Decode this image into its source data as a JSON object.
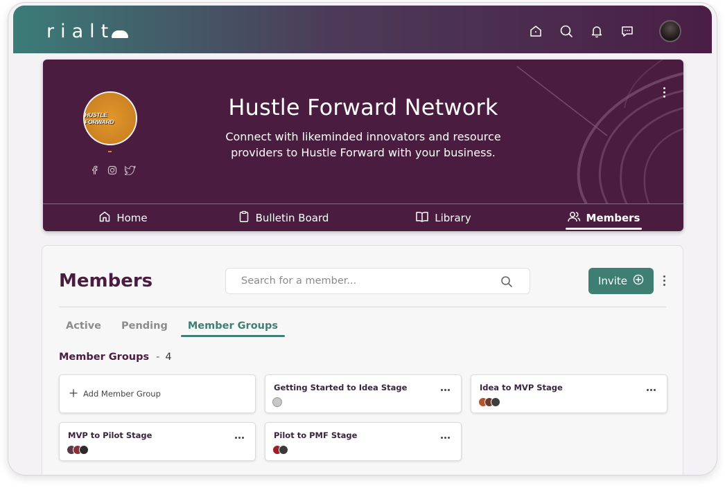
{
  "app": {
    "logo_text": "rialt"
  },
  "topbar": {
    "icons": [
      "home-icon",
      "search-icon",
      "bell-icon",
      "chat-icon",
      "user-avatar"
    ]
  },
  "community": {
    "name": "Hustle Forward Network",
    "description": "Connect with likeminded innovators and resource providers to Hustle Forward with your business.",
    "logo_text": "HUSTLE FORWARD",
    "socials": [
      "facebook-icon",
      "instagram-icon",
      "twitter-icon"
    ]
  },
  "nav": [
    {
      "label": "Home",
      "icon": "home-icon"
    },
    {
      "label": "Bulletin Board",
      "icon": "clipboard-icon"
    },
    {
      "label": "Library",
      "icon": "book-icon"
    },
    {
      "label": "Members",
      "icon": "users-icon",
      "active": true
    }
  ],
  "members": {
    "title": "Members",
    "search_placeholder": "Search for a member...",
    "invite_label": "Invite",
    "tabs": [
      {
        "label": "Active"
      },
      {
        "label": "Pending"
      },
      {
        "label": "Member Groups",
        "active": true
      }
    ],
    "groups_label": "Member Groups",
    "groups_separator": "-",
    "groups_count": "4",
    "add_group_label": "Add Member Group",
    "groups": [
      {
        "name": "Getting Started to Idea Stage"
      },
      {
        "name": "Idea to MVP Stage"
      },
      {
        "name": "MVP to Pilot Stage"
      },
      {
        "name": "Pilot to PMF Stage"
      }
    ]
  },
  "colors": {
    "brand_plum": "#4a1c40",
    "accent_teal": "#3f7f73"
  }
}
